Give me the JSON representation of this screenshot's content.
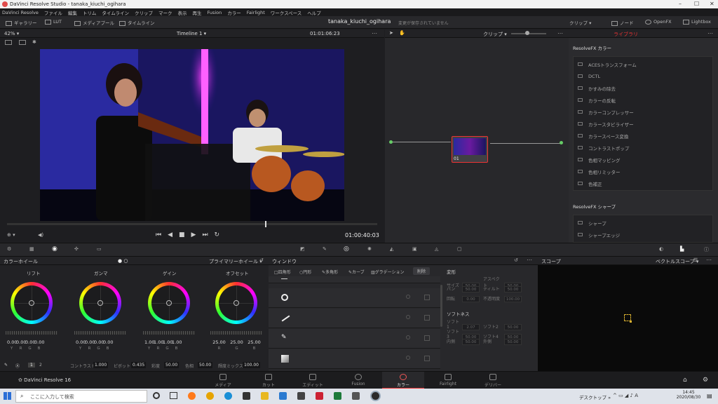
{
  "titlebar": {
    "title": "DaVinci Resolve Studio - tanaka_kiuchi_ogihara"
  },
  "menu": [
    "DaVinci Resolve",
    "ファイル",
    "編集",
    "トリム",
    "タイムライン",
    "クリップ",
    "マーク",
    "表示",
    "再生",
    "Fusion",
    "カラー",
    "Fairlight",
    "ワークスペース",
    "ヘルプ"
  ],
  "toolbar": {
    "gallery": "ギャラリー",
    "lut": "LUT",
    "media_pool": "メディアプール",
    "timeline": "タイムライン",
    "project_name": "tanaka_kiuchi_ogihara",
    "save_status": "変更が保存されていません",
    "clips": "クリップ",
    "nodes": "ノード",
    "openfx": "OpenFX",
    "lightbox": "Lightbox"
  },
  "viewer": {
    "zoom": "42%",
    "timeline_name": "Timeline 1",
    "timecode_top": "01:01:06:23",
    "timecode_bottom": "01:00:40:03"
  },
  "node_editor": {
    "mode": "クリップ",
    "node_label": "01"
  },
  "library": {
    "tab_library": "ライブラリ",
    "section1_title": "ResolveFX カラー",
    "section1_items": [
      "ACESトランスフォーム",
      "DCTL",
      "かすみの除去",
      "カラーの反転",
      "カラーコンプレッサー",
      "カラースタビライザー",
      "カラースペース変換",
      "コントラストポップ",
      "色相マッピング",
      "色相リミッター",
      "色補正"
    ],
    "section2_title": "ResolveFX シャープ",
    "section2_items": [
      "シャープ",
      "シャープエッジ"
    ]
  },
  "color_wheels": {
    "title": "カラーホイール",
    "mode": "プライマリーホイール",
    "wheels": [
      {
        "label": "リフト",
        "values": [
          "0.00",
          "0.00",
          "0.00",
          "0.00"
        ]
      },
      {
        "label": "ガンマ",
        "values": [
          "0.00",
          "0.00",
          "0.00",
          "0.00"
        ]
      },
      {
        "label": "ゲイン",
        "values": [
          "1.00",
          "1.00",
          "1.00",
          "1.00"
        ]
      },
      {
        "label": "オフセット",
        "values": [
          "25.00",
          "25.00",
          "25.00"
        ]
      }
    ],
    "channels4": [
      "Y",
      "R",
      "G",
      "B"
    ],
    "channels3": [
      "R",
      "G",
      "B"
    ],
    "page1": "1",
    "page2": "2",
    "contrast_label": "コントラスト",
    "contrast": "1.000",
    "pivot_label": "ピボット",
    "pivot": "0.435",
    "saturation_label": "彩度",
    "saturation": "50.00",
    "hue_label": "色相",
    "hue": "50.00",
    "lum_mix_label": "輝度ミックス",
    "lum_mix": "100.00"
  },
  "window_panel": {
    "title": "ウィンドウ",
    "tools": [
      "四角形",
      "円形",
      "多角形",
      "カーブ",
      "グラデーション"
    ],
    "delete": "削除",
    "transform_title": "変形",
    "transform_props": [
      [
        "サイズ",
        "50.00",
        "アスペクト",
        "50.00"
      ],
      [
        "パン",
        "50.00",
        "ティルト",
        "50.00"
      ],
      [
        "回転",
        "0.00",
        "不透明度",
        "100.00"
      ]
    ],
    "softness_title": "ソフトネス",
    "softness_props": [
      [
        "ソフト1",
        "2.07",
        "ソフト2",
        "50.00"
      ],
      [
        "ソフト3",
        "50.00",
        "ソフト4",
        "50.00"
      ],
      [
        "内側",
        "50.00",
        "外側",
        "50.00"
      ]
    ]
  },
  "scope": {
    "title": "スコープ",
    "mode": "ベクトルスコープ"
  },
  "pages": {
    "app_name": "DaVinci Resolve 16",
    "items": [
      "メディア",
      "カット",
      "エディット",
      "Fusion",
      "カラー",
      "Fairlight",
      "デリバー"
    ],
    "active": "カラー"
  },
  "taskbar": {
    "search_placeholder": "ここに入力して検索",
    "desktop": "デスクトップ",
    "time": "14:45",
    "date": "2020/08/30"
  },
  "colors": {
    "accent_red": "#e03a3a",
    "panel_bg": "#222225"
  }
}
